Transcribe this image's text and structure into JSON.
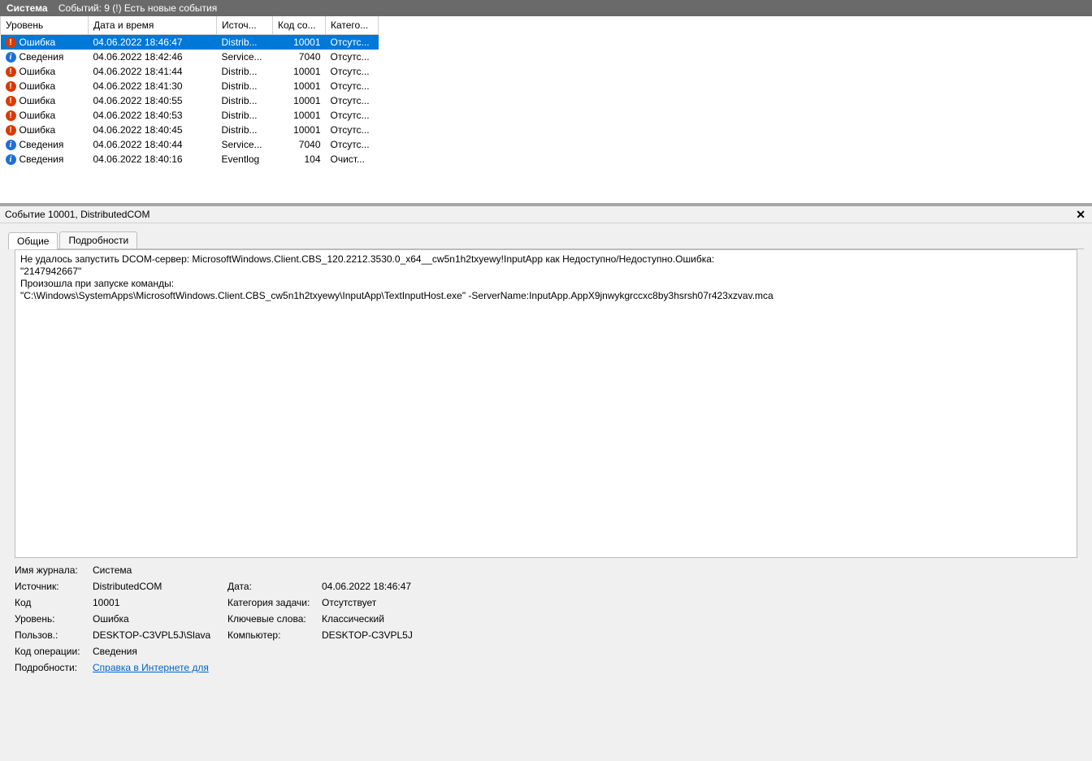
{
  "titlebar": {
    "system": "Система",
    "status": "Событий: 9 (!) Есть новые события"
  },
  "columns": {
    "level": "Уровень",
    "datetime": "Дата и время",
    "source": "Источ...",
    "code": "Код со...",
    "category": "Катего..."
  },
  "events": [
    {
      "lvl": "error",
      "level": "Ошибка",
      "dt": "04.06.2022 18:46:47",
      "src": "Distrib...",
      "code": "10001",
      "cat": "Отсутс...",
      "selected": true
    },
    {
      "lvl": "info",
      "level": "Сведения",
      "dt": "04.06.2022 18:42:46",
      "src": "Service...",
      "code": "7040",
      "cat": "Отсутс..."
    },
    {
      "lvl": "error",
      "level": "Ошибка",
      "dt": "04.06.2022 18:41:44",
      "src": "Distrib...",
      "code": "10001",
      "cat": "Отсутс..."
    },
    {
      "lvl": "error",
      "level": "Ошибка",
      "dt": "04.06.2022 18:41:30",
      "src": "Distrib...",
      "code": "10001",
      "cat": "Отсутс..."
    },
    {
      "lvl": "error",
      "level": "Ошибка",
      "dt": "04.06.2022 18:40:55",
      "src": "Distrib...",
      "code": "10001",
      "cat": "Отсутс..."
    },
    {
      "lvl": "error",
      "level": "Ошибка",
      "dt": "04.06.2022 18:40:53",
      "src": "Distrib...",
      "code": "10001",
      "cat": "Отсутс..."
    },
    {
      "lvl": "error",
      "level": "Ошибка",
      "dt": "04.06.2022 18:40:45",
      "src": "Distrib...",
      "code": "10001",
      "cat": "Отсутс..."
    },
    {
      "lvl": "info",
      "level": "Сведения",
      "dt": "04.06.2022 18:40:44",
      "src": "Service...",
      "code": "7040",
      "cat": "Отсутс..."
    },
    {
      "lvl": "info",
      "level": "Сведения",
      "dt": "04.06.2022 18:40:16",
      "src": "Eventlog",
      "code": "104",
      "cat": "Очист..."
    }
  ],
  "detail": {
    "header": "Событие 10001, DistributedCOM",
    "tabs": {
      "general": "Общие",
      "details": "Подробности"
    },
    "message": "Не удалось запустить DCOM-сервер: MicrosoftWindows.Client.CBS_120.2212.3530.0_x64__cw5n1h2txyewy!InputApp как Недоступно/Недоступно.Ошибка:\n\"2147942667\"\nПроизошла при запуске команды:\n\"C:\\Windows\\SystemApps\\MicrosoftWindows.Client.CBS_cw5n1h2txyewy\\InputApp\\TextInputHost.exe\" -ServerName:InputApp.AppX9jnwykgrccxc8by3hsrsh07r423xzvav.mca",
    "labels": {
      "logName": "Имя журнала:",
      "source": "Источник:",
      "date": "Дата:",
      "code": "Код",
      "taskCategory": "Категория задачи:",
      "level": "Уровень:",
      "keywords": "Ключевые слова:",
      "user": "Пользов.:",
      "computer": "Компьютер:",
      "opcode": "Код операции:",
      "moreInfo": "Подробности:",
      "helpLink": "Справка в Интернете для"
    },
    "values": {
      "logName": "Система",
      "source": "DistributedCOM",
      "date": "04.06.2022 18:46:47",
      "code": "10001",
      "taskCategory": "Отсутствует",
      "level": "Ошибка",
      "keywords": "Классический",
      "user": "DESKTOP-C3VPL5J\\Slava",
      "computer": "DESKTOP-C3VPL5J",
      "opcode": "Сведения"
    }
  }
}
